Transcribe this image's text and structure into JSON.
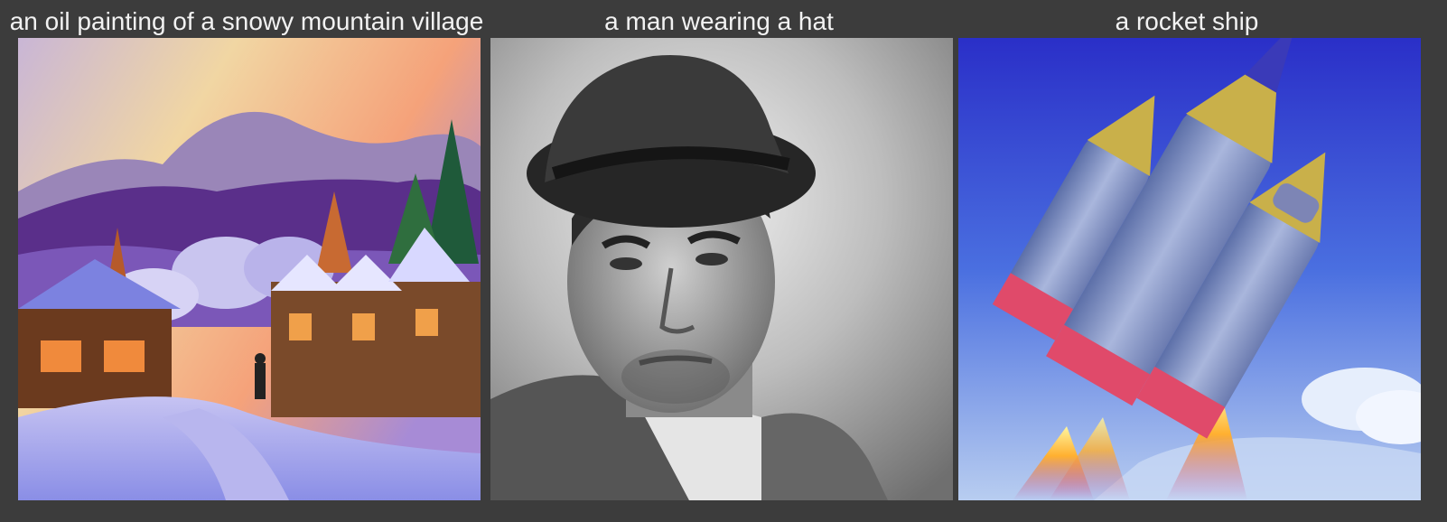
{
  "gallery": {
    "items": [
      {
        "caption": "an oil painting of a snowy mountain village",
        "image_subject": "snowy-village-painting"
      },
      {
        "caption": "a man wearing a hat",
        "image_subject": "man-portrait"
      },
      {
        "caption": "a rocket ship",
        "image_subject": "rocket-ship"
      }
    ]
  },
  "colors": {
    "background": "#3c3c3c",
    "caption_text": "#f2f2f2"
  }
}
